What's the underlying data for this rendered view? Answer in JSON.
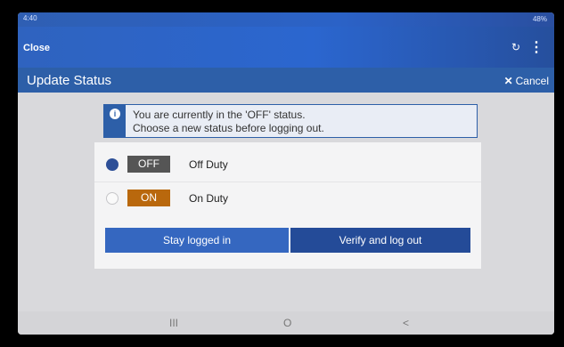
{
  "statusbar": {
    "time": "4:40",
    "system": "48%"
  },
  "appbar": {
    "close_label": "Close",
    "refresh_icon": "refresh-icon",
    "menu_icon": "more-vert-icon"
  },
  "titlebar": {
    "title": "Update Status",
    "cancel_label": "Cancel"
  },
  "info": {
    "line1": "You are currently in the 'OFF' status.",
    "line2": "Choose a new status before logging out."
  },
  "statuses": [
    {
      "tag": "OFF",
      "label": "Off Duty",
      "selected": true,
      "color": "#555555"
    },
    {
      "tag": "ON",
      "label": "On Duty",
      "selected": false,
      "color": "#b9680d"
    }
  ],
  "buttons": {
    "stay": "Stay logged in",
    "verify": "Verify and log out"
  },
  "navbar": {
    "recent": "III",
    "home": "O",
    "back": "<"
  },
  "colors": {
    "primary": "#2d5fa8",
    "button_light": "#3567c0",
    "button_dark": "#244b98"
  }
}
